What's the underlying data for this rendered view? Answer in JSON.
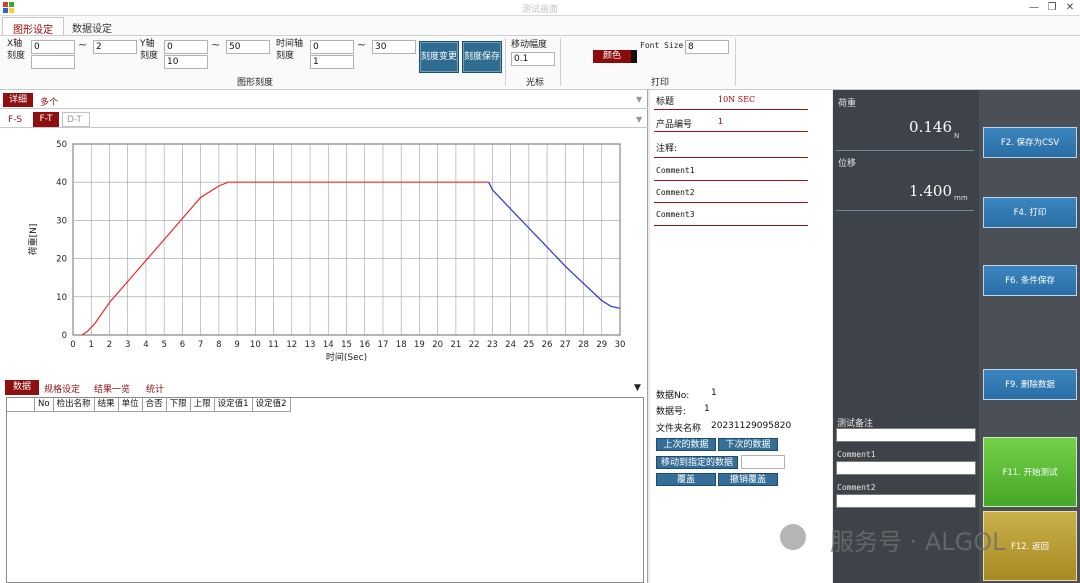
{
  "window": {
    "title": "测试画面",
    "controls": [
      "—",
      "❐",
      "✕"
    ]
  },
  "ribbon": {
    "tabs": [
      "图形设定",
      "数据设定"
    ],
    "x_axis": {
      "label": "X轴\n刻度",
      "min": "0",
      "max": "2",
      "step": ""
    },
    "y_axis": {
      "label": "Y轴\n刻度",
      "min": "0",
      "max": "50",
      "step": "10"
    },
    "t_axis": {
      "label": "时间轴\n刻度",
      "min": "0",
      "max": "30",
      "step": "1"
    },
    "tilde": "~",
    "btn_change": "刻度变更",
    "btn_save": "刻度保存",
    "group_scale": "图形刻度",
    "move_label": "移动幅度",
    "move_value": "0.1",
    "group_cursor": "光标",
    "color_btn": "颜色",
    "font_size_label": "Font Size",
    "font_size_value": "8",
    "group_print": "打印"
  },
  "left": {
    "detail_tab": "详细",
    "multi_tab": "多个",
    "chart_tabs": [
      "F-S",
      "F-T",
      "D-T"
    ],
    "bottom_tabs": [
      "数据",
      "规格设定",
      "结果一览",
      "统计"
    ],
    "table_headers": [
      "No",
      "检出名称",
      "结果",
      "单位",
      "合否",
      "下限",
      "上限",
      "设定值1",
      "设定值2"
    ]
  },
  "chart_data": {
    "type": "line",
    "xlabel": "时间(Sec)",
    "ylabel": "荷重[N]",
    "xlim": [
      0,
      30
    ],
    "ylim": [
      0,
      50
    ],
    "xticks": [
      0,
      1,
      2,
      3,
      4,
      5,
      6,
      7,
      8,
      9,
      10,
      11,
      12,
      13,
      14,
      15,
      16,
      17,
      18,
      19,
      20,
      21,
      22,
      23,
      24,
      25,
      26,
      27,
      28,
      29,
      30
    ],
    "yticks": [
      0,
      10,
      20,
      30,
      40,
      50
    ],
    "grid": true,
    "series": [
      {
        "color": "#e8282a",
        "x": [
          0.5,
          0.8,
          1.2,
          2,
          3,
          4,
          5,
          6,
          7,
          8,
          8.5,
          9,
          12,
          16,
          20,
          22.8
        ],
        "y": [
          0,
          1,
          3,
          8.5,
          14,
          19.5,
          25,
          30.5,
          36,
          39,
          40,
          40,
          40,
          40,
          40,
          40
        ]
      },
      {
        "color": "#2336d8",
        "x": [
          22.8,
          23,
          24,
          25,
          26,
          27,
          28,
          29,
          29.5,
          30
        ],
        "y": [
          40,
          38,
          33,
          28,
          23,
          18,
          13.5,
          9,
          7.5,
          7
        ]
      }
    ]
  },
  "info": {
    "title_label": "标题",
    "title_value": "10N SEC",
    "product_label": "产品编号",
    "product_value": "1",
    "note_label": "注释:",
    "comments": [
      "Comment1",
      "Comment2",
      "Comment3"
    ],
    "data_no_label": "数据No:",
    "data_no_value": "1",
    "data_num_label": "数据号:",
    "data_num_value": "1",
    "folder_label": "文件夹名称",
    "folder_value": "20231129095820",
    "btn_prev": "上次的数据",
    "btn_next": "下次的数据",
    "btn_goto": "移动到指定的数据",
    "btn_overwrite": "覆盖",
    "btn_undo": "撤销覆盖"
  },
  "readout": {
    "load_label": "荷重",
    "load_value": "0.146",
    "load_unit": "N",
    "disp_label": "位移",
    "disp_value": "1.400",
    "disp_unit": "mm",
    "test_note_label": "测试备注",
    "comment1_label": "Comment1",
    "comment2_label": "Comment2"
  },
  "functions": {
    "f2": "F2. 保存为CSV",
    "f4": "F4. 打印",
    "f6": "F6. 条件保存",
    "f9": "F9. 删除数据",
    "f11": "F11. 开始测试",
    "f12": "F12. 返回"
  },
  "watermark": "服务号 · ALGOL"
}
